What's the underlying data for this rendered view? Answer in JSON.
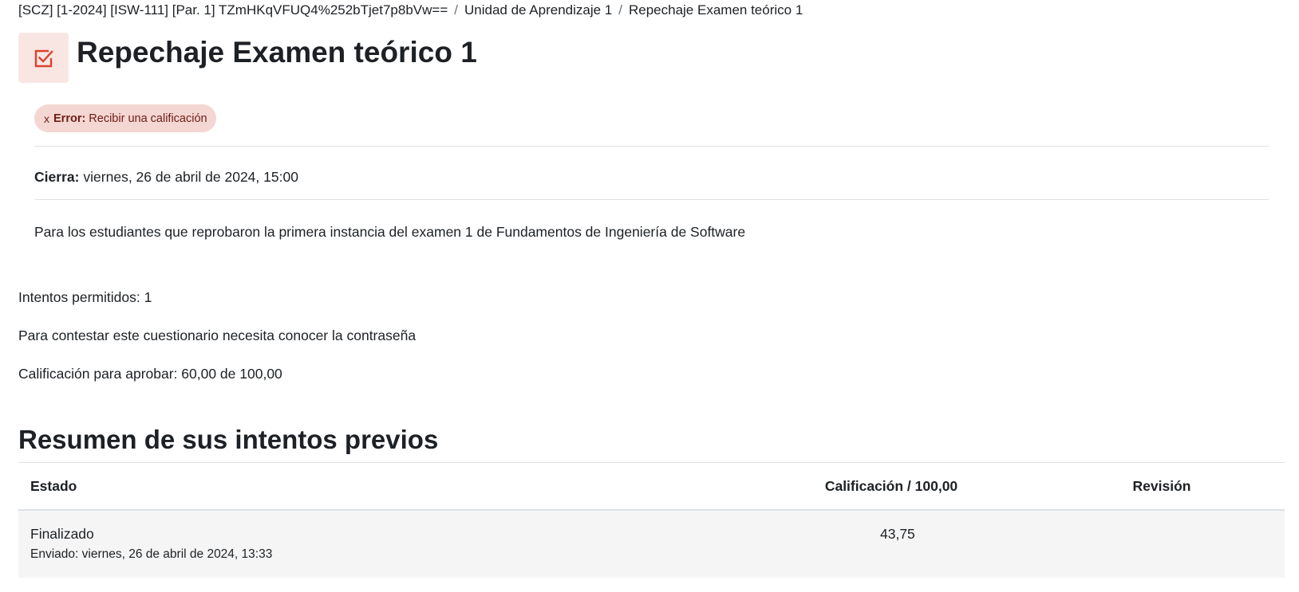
{
  "breadcrumb": {
    "items": [
      "[SCZ] [1-2024] [ISW-111] [Par. 1] TZmHKqVFUQ4%252bTjet7p8bVw==",
      "Unidad de Aprendizaje 1",
      "Repechaje Examen teórico 1"
    ],
    "separator": "/"
  },
  "header": {
    "icon": "quiz-checkbox-icon",
    "icon_color": "#d9432f",
    "title": "Repechaje Examen teórico 1"
  },
  "completion": {
    "icon": "x",
    "status_label": "Error:",
    "requirement": "Recibir una calificación"
  },
  "dates": {
    "label": "Cierra:",
    "value": "viernes, 26 de abril de 2024, 15:00"
  },
  "description": "Para los estudiantes que reprobaron la primera instancia del examen 1 de Fundamentos de Ingeniería de Software",
  "quiz_info": {
    "attempts_allowed": "Intentos permitidos: 1",
    "password_notice": "Para contestar este cuestionario necesita conocer la contraseña",
    "pass_grade": "Calificación para aprobar: 60,00 de 100,00"
  },
  "summary": {
    "heading": "Resumen de sus intentos previos",
    "columns": [
      "Estado",
      "Calificación / 100,00",
      "Revisión"
    ],
    "rows": [
      {
        "state": "Finalizado",
        "submitted": "Enviado: viernes, 26 de abril de 2024, 13:33",
        "grade": "43,75",
        "review": ""
      }
    ]
  }
}
